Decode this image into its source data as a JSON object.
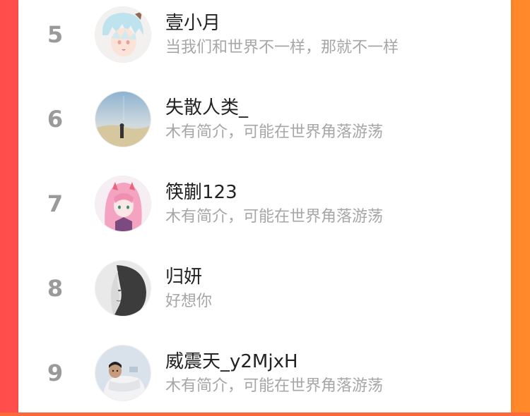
{
  "users": [
    {
      "rank": "5",
      "name": "壹小月",
      "bio": "当我们和世界不一样，那就不一样"
    },
    {
      "rank": "6",
      "name": "失散人类_",
      "bio": "木有简介，可能在世界角落游荡"
    },
    {
      "rank": "7",
      "name": "筷蒯123",
      "bio": "木有简介，可能在世界角落游荡"
    },
    {
      "rank": "8",
      "name": "归妍",
      "bio": "好想你"
    },
    {
      "rank": "9",
      "name": "威震天_y2MjxH",
      "bio": "木有简介，可能在世界角落游荡"
    }
  ],
  "colors": {
    "accent_left": "#ff4d4d",
    "accent_right": "#ff8a2a",
    "rank_gray": "#9a9a9a",
    "bio_gray": "#a6a6a6"
  }
}
